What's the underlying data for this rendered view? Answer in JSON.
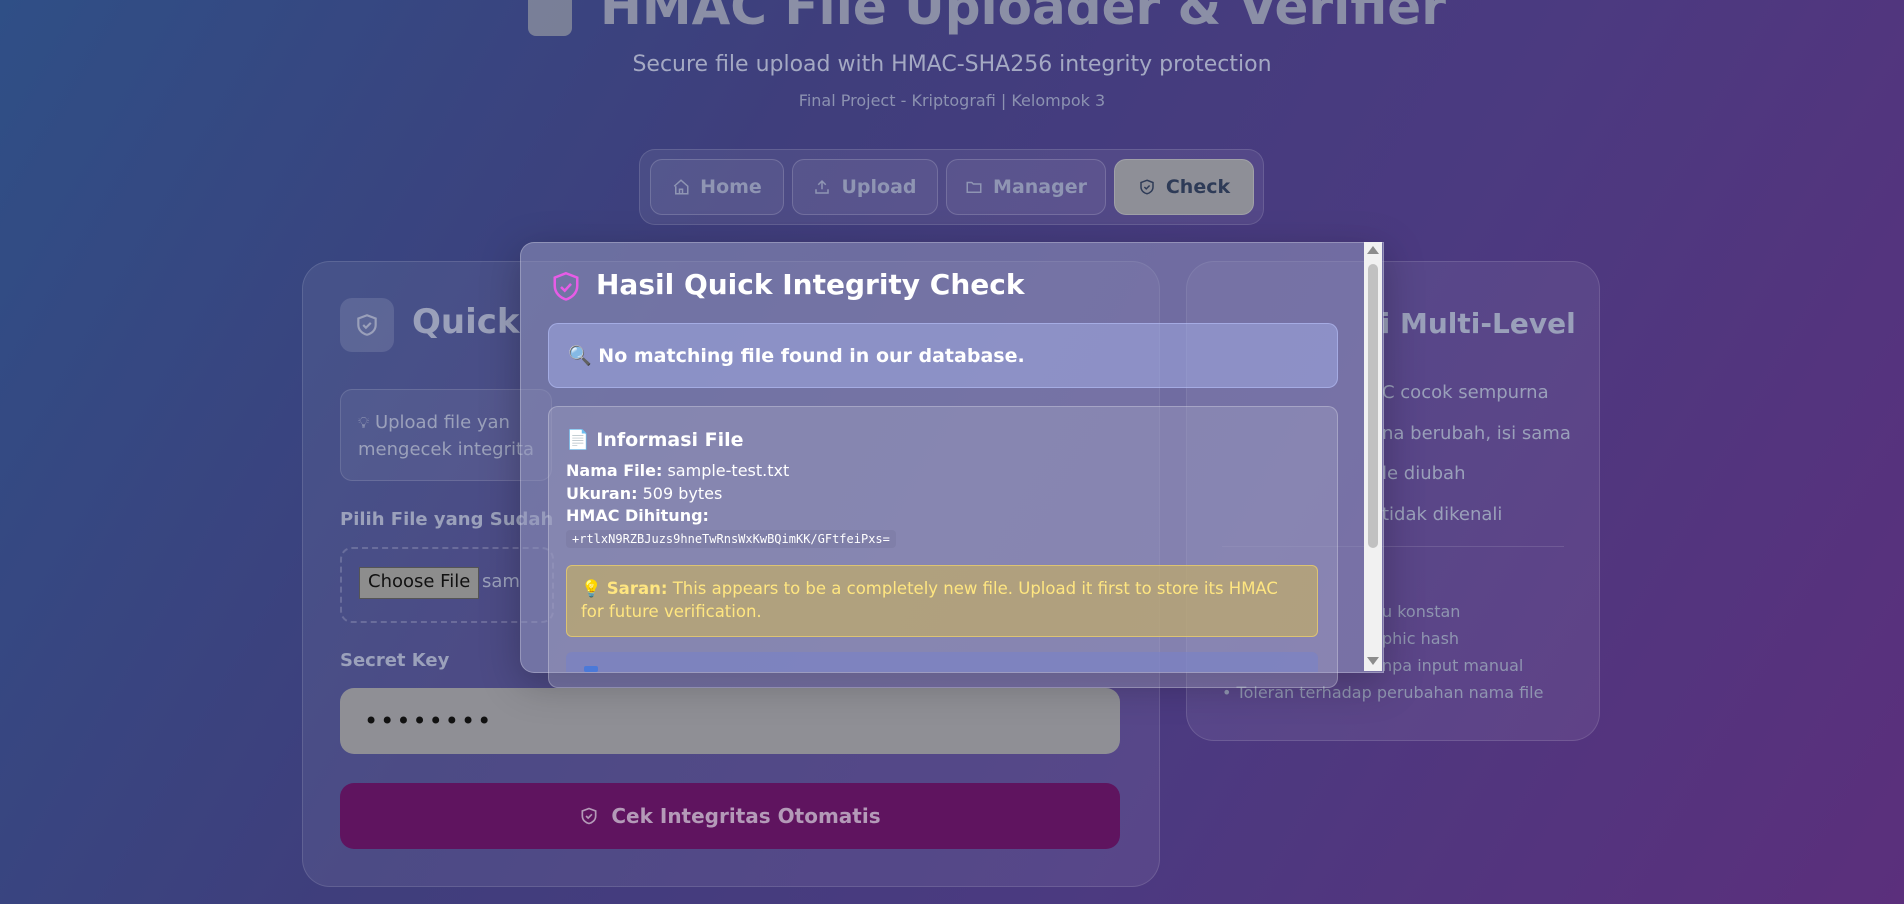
{
  "header": {
    "title": "HMAC File Uploader & Verifier",
    "subtitle": "Secure file upload with HMAC-SHA256 integrity protection",
    "meta": "Final Project - Kriptografi | Kelompok 3"
  },
  "nav": {
    "items": [
      {
        "label": "Home",
        "icon": "home-icon"
      },
      {
        "label": "Upload",
        "icon": "upload-icon"
      },
      {
        "label": "Manager",
        "icon": "folder-icon"
      },
      {
        "label": "Check",
        "icon": "shield-check-icon",
        "active": true
      }
    ]
  },
  "left_card": {
    "title": "Quick",
    "tip": "Upload file yan mengecek integrita",
    "file_label": "Pilih File yang Sudah",
    "choose_button": "Choose File",
    "file_name_fragment": "sam",
    "secret_label": "Secret Key",
    "secret_value": "••••••••",
    "submit_label": "Cek Integritas Otomatis"
  },
  "right_card": {
    "title": "si Multi-Level",
    "lines": [
      "C cocok sempurna",
      "na berubah, isi sama",
      "le diubah",
      "tidak dikenali"
    ],
    "features": [
      "u konstan",
      "phic hash",
      "npa input manual",
      "• Toleran terhadap perubahan nama file"
    ]
  },
  "modal": {
    "title": "Hasil Quick Integrity Check",
    "message_icon": "magnifier-icon",
    "message": "No matching file found in our database.",
    "info_heading": "Informasi File",
    "info_icon": "document-icon",
    "name_label": "Nama File:",
    "name_value": "sample-test.txt",
    "size_label": "Ukuran:",
    "size_value": "509 bytes",
    "hmac_label": "HMAC Dihitung:",
    "hmac_value": "+rtlxN9RZBJuzs9hneTwRnsWxKwBQimKK/GFtfeiPxs=",
    "saran_label": "Saran:",
    "saran_text": "This appears to be a completely new file. Upload it first to store its HMAC for future verification.",
    "saran_icon": "lightbulb-icon"
  },
  "colors": {
    "accent": "#5f145f",
    "shield": "#e75ce6",
    "saran_text": "#ffe680"
  }
}
